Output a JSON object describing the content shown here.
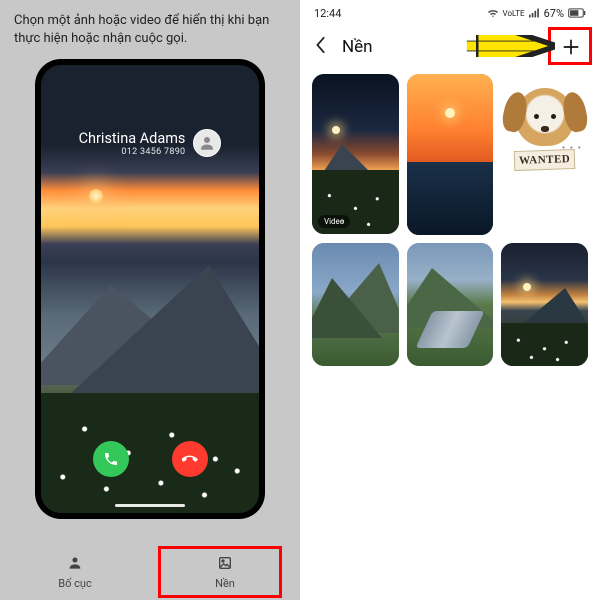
{
  "left": {
    "instruction": "Chọn một ảnh hoặc video để hiển thị khi bạn thực hiện hoặc nhận cuộc gọi.",
    "caller_name": "Christina Adams",
    "caller_number": "012 3456 7890",
    "tabs": {
      "layout": "Bố cục",
      "background": "Nền"
    }
  },
  "right": {
    "status": {
      "time": "12:44",
      "network": "VoLTE",
      "battery": "67%"
    },
    "header_title": "Nền",
    "video_badge": "Video",
    "wanted_label": "WANTED"
  }
}
